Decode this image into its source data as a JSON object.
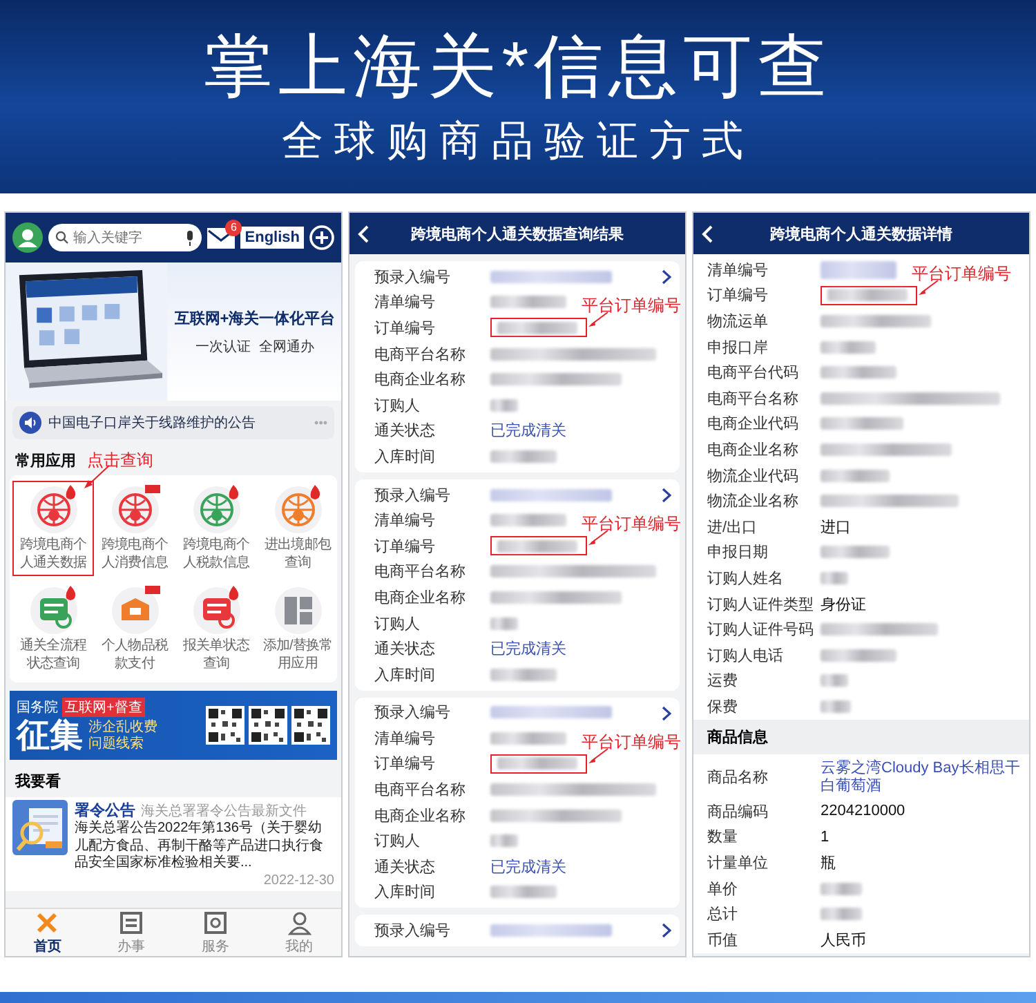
{
  "banner": {
    "title": "掌上海关*信息可查",
    "subtitle": "全球购商品验证方式"
  },
  "home": {
    "search": {
      "placeholder": "输入关键字"
    },
    "mail_badge": "6",
    "language_button": "English",
    "promo": {
      "title": "互联网+海关一体化平台",
      "subtitle": "一次认证  全网通办"
    },
    "notice": "中国电子口岸关于线路维护的公告",
    "notice_more": "•••",
    "apps_title": "常用应用",
    "apps_annotation": "点击查询",
    "apps": [
      {
        "label": "跨境电商个人通关数据",
        "color": "#e8383d",
        "kind": "hot",
        "highlighted": true
      },
      {
        "label": "跨境电商个人消费信息",
        "color": "#e8383d",
        "kind": "new",
        "highlighted": false
      },
      {
        "label": "跨境电商个人税款信息",
        "color": "#3aa35a",
        "kind": "hot",
        "highlighted": false
      },
      {
        "label": "进出境邮包查询",
        "color": "#ef7d2b",
        "kind": "hot",
        "highlighted": false
      },
      {
        "label": "通关全流程状态查询",
        "color": "#3aa35a",
        "kind": "hot",
        "highlighted": false
      },
      {
        "label": "个人物品税款支付",
        "color": "#ef7d2b",
        "kind": "new",
        "highlighted": false
      },
      {
        "label": "报关单状态查询",
        "color": "#e8383d",
        "kind": "hot",
        "highlighted": false
      },
      {
        "label": "添加/替换常用应用",
        "color": "#8a8d93",
        "kind": "plain",
        "highlighted": false
      }
    ],
    "ad": {
      "source": "国务院",
      "tag": "互联网+督查",
      "headline": "征集",
      "lines": [
        "涉企乱收费",
        "问题线索"
      ]
    },
    "feed_title": "我要看",
    "news": [
      {
        "category": "署令公告",
        "source": "海关总署署令公告最新文件",
        "headline": "海关总署公告2022年第136号（关于婴幼儿配方食品、再制干酪等产品进口执行食品安全国家标准检验相关要...",
        "date": "2022-12-30"
      }
    ],
    "nav": [
      {
        "label": "首页",
        "selected": true
      },
      {
        "label": "办事",
        "selected": false
      },
      {
        "label": "服务",
        "selected": false
      },
      {
        "label": "我的",
        "selected": false
      }
    ]
  },
  "results": {
    "title": "跨境电商个人通关数据查询结果",
    "cards": [
      {
        "rows": [
          {
            "label": "预录入编号",
            "kind": "blurred-link",
            "highlighted": false
          },
          {
            "label": "清单编号",
            "kind": "blurred",
            "highlighted": false
          },
          {
            "label": "订单编号",
            "kind": "blurred",
            "highlighted": true,
            "annotation": "平台订单编号"
          },
          {
            "label": "电商平台名称",
            "kind": "blurred",
            "highlighted": false
          },
          {
            "label": "电商企业名称",
            "kind": "blurred",
            "highlighted": false
          },
          {
            "label": "订购人",
            "kind": "blurred",
            "highlighted": false
          },
          {
            "label": "通关状态",
            "kind": "link",
            "value": "已完成清关",
            "highlighted": false
          },
          {
            "label": "入库时间",
            "kind": "blurred",
            "highlighted": false
          }
        ]
      },
      {
        "rows": [
          {
            "label": "预录入编号",
            "kind": "blurred-link",
            "highlighted": false
          },
          {
            "label": "清单编号",
            "kind": "blurred",
            "highlighted": false
          },
          {
            "label": "订单编号",
            "kind": "blurred",
            "highlighted": true,
            "annotation": "平台订单编号"
          },
          {
            "label": "电商平台名称",
            "kind": "blurred",
            "highlighted": false
          },
          {
            "label": "电商企业名称",
            "kind": "blurred",
            "highlighted": false
          },
          {
            "label": "订购人",
            "kind": "blurred",
            "highlighted": false
          },
          {
            "label": "通关状态",
            "kind": "link",
            "value": "已完成清关",
            "highlighted": false
          },
          {
            "label": "入库时间",
            "kind": "blurred",
            "highlighted": false
          }
        ]
      },
      {
        "rows": [
          {
            "label": "预录入编号",
            "kind": "blurred-link",
            "highlighted": false
          },
          {
            "label": "清单编号",
            "kind": "blurred",
            "highlighted": false
          },
          {
            "label": "订单编号",
            "kind": "blurred",
            "highlighted": true,
            "annotation": "平台订单编号"
          },
          {
            "label": "电商平台名称",
            "kind": "blurred",
            "highlighted": false
          },
          {
            "label": "电商企业名称",
            "kind": "blurred",
            "highlighted": false
          },
          {
            "label": "订购人",
            "kind": "blurred",
            "highlighted": false
          },
          {
            "label": "通关状态",
            "kind": "link",
            "value": "已完成清关",
            "highlighted": false
          },
          {
            "label": "入库时间",
            "kind": "blurred",
            "highlighted": false
          }
        ]
      },
      {
        "rows": [
          {
            "label": "预录入编号",
            "kind": "blurred-link",
            "highlighted": false
          }
        ]
      }
    ]
  },
  "detail": {
    "title": "跨境电商个人通关数据详情",
    "rows": [
      {
        "label": "清单编号",
        "kind": "blurred-link",
        "highlighted": false
      },
      {
        "label": "订单编号",
        "kind": "blurred",
        "highlighted": true,
        "annotation": "平台订单编号"
      },
      {
        "label": "物流运单",
        "kind": "blurred",
        "highlighted": false
      },
      {
        "label": "申报口岸",
        "kind": "blurred",
        "highlighted": false
      },
      {
        "label": "电商平台代码",
        "kind": "blurred",
        "highlighted": false
      },
      {
        "label": "电商平台名称",
        "kind": "blurred",
        "highlighted": false
      },
      {
        "label": "电商企业代码",
        "kind": "blurred",
        "highlighted": false
      },
      {
        "label": "电商企业名称",
        "kind": "blurred",
        "highlighted": false
      },
      {
        "label": "物流企业代码",
        "kind": "blurred",
        "highlighted": false
      },
      {
        "label": "物流企业名称",
        "kind": "blurred",
        "highlighted": false
      },
      {
        "label": "进/出口",
        "kind": "text",
        "value": "进口",
        "highlighted": false
      },
      {
        "label": "申报日期",
        "kind": "blurred",
        "highlighted": false
      },
      {
        "label": "订购人姓名",
        "kind": "blurred",
        "highlighted": false
      },
      {
        "label": "订购人证件类型",
        "kind": "text",
        "value": "身份证",
        "highlighted": false
      },
      {
        "label": "订购人证件号码",
        "kind": "blurred",
        "highlighted": false
      },
      {
        "label": "订购人电话",
        "kind": "blurred",
        "highlighted": false
      },
      {
        "label": "运费",
        "kind": "blurred",
        "highlighted": false
      },
      {
        "label": "保费",
        "kind": "blurred",
        "highlighted": false
      }
    ],
    "section": "商品信息",
    "goods_rows": [
      {
        "label": "商品名称",
        "kind": "link",
        "value": "云雾之湾Cloudy Bay长相思干白葡萄酒",
        "highlighted": false
      },
      {
        "label": "商品编码",
        "kind": "text",
        "value": "2204210000",
        "highlighted": false
      },
      {
        "label": "数量",
        "kind": "text",
        "value": "1",
        "highlighted": false
      },
      {
        "label": "计量单位",
        "kind": "text",
        "value": "瓶",
        "highlighted": false
      },
      {
        "label": "单价",
        "kind": "blurred",
        "highlighted": false
      },
      {
        "label": "总计",
        "kind": "blurred",
        "highlighted": false
      },
      {
        "label": "币值",
        "kind": "text",
        "value": "人民币",
        "highlighted": false
      }
    ]
  }
}
